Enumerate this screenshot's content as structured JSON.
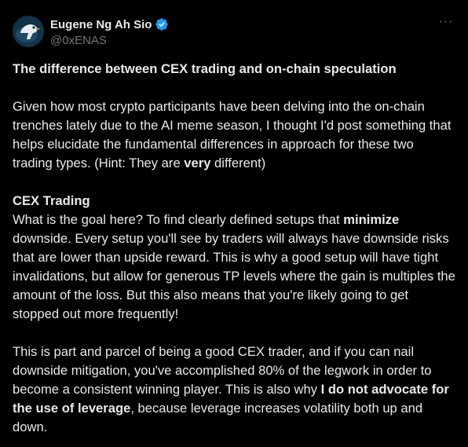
{
  "author": {
    "display_name": "Eugene Ng Ah Sio",
    "handle": "@0xENAS",
    "verified_color": "#1d9bf0",
    "icon": "verified-badge-icon"
  },
  "more_icon": "more-options-icon",
  "post": {
    "title": "The difference between CEX trading and on-chain speculation",
    "p1": {
      "text": "Given how most crypto participants have been delving into the on-chain trenches lately due to the AI meme season, I thought I'd post something that helps elucidate the fundamental differences in approach for these two trading types. (Hint: They are ",
      "bold": "very",
      "tail": " different)"
    },
    "section_heading": "CEX Trading",
    "p2": {
      "text": "What is the goal here? To find clearly defined setups that ",
      "bold": "minimize",
      "tail": " downside. Every setup you'll see by traders will always have downside risks that are lower than upside reward. This is why a good setup will have tight invalidations, but allow for generous TP levels where the gain is multiples the amount of the loss. But this also means that you're likely going to get stopped out more frequently!"
    },
    "p3": {
      "text": "This is part and parcel of being a good CEX trader, and if you can nail downside mitigation, you've accomplished 80% of the legwork in order to become a consistent winning player. This is also why ",
      "bold": "I do not advocate for the use of leverage",
      "tail": ", because leverage increases volatility both up and down."
    }
  },
  "colors": {
    "background": "#000000",
    "text": "#e7e9ea",
    "muted": "#71767b"
  }
}
